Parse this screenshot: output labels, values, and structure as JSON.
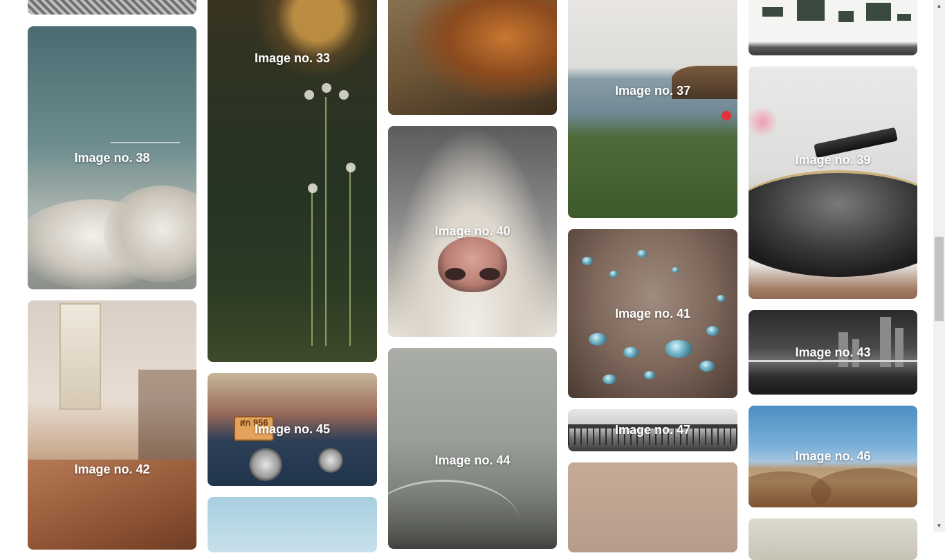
{
  "gallery": {
    "images": [
      {
        "label": "Image no. 33"
      },
      {
        "label": "Image no. 37"
      },
      {
        "label": "Image no. 38"
      },
      {
        "label": "Image no. 39"
      },
      {
        "label": "Image no. 40"
      },
      {
        "label": "Image no. 41"
      },
      {
        "label": "Image no. 42"
      },
      {
        "label": "Image no. 43"
      },
      {
        "label": "Image no. 44"
      },
      {
        "label": "Image no. 45"
      },
      {
        "label": "Image no. 46"
      },
      {
        "label": "Image no. 47"
      }
    ],
    "plate_text": "สก 956"
  },
  "scrollbar": {
    "up_icon": "triangle-up-icon",
    "down_icon": "triangle-down-icon",
    "thumb_color": "#c1c1c1",
    "track_color": "#f1f1f1"
  },
  "colors": {
    "caption_text": "#ffffff",
    "background": "#ffffff"
  }
}
